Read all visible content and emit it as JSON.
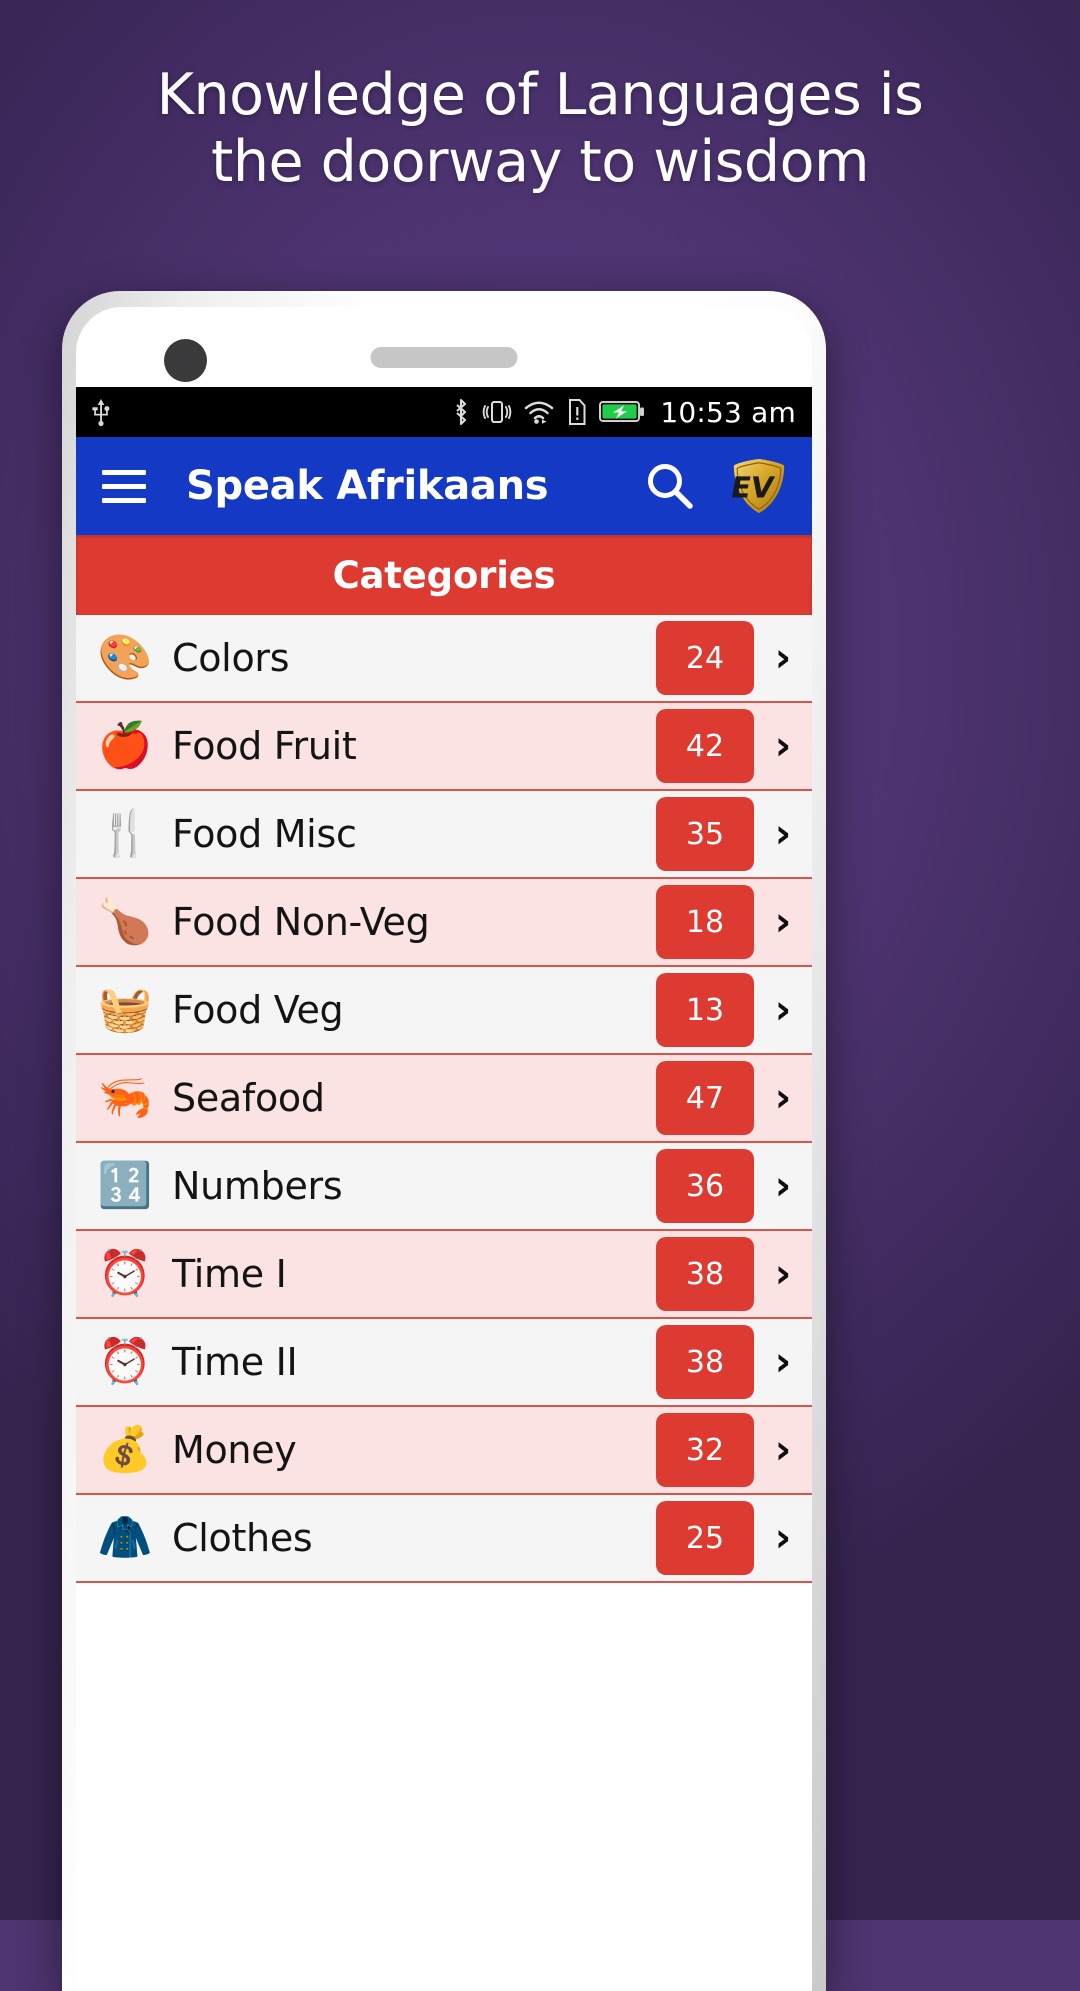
{
  "promo": {
    "headline_line1": "Knowledge of Languages is",
    "headline_line2": "the doorway to wisdom"
  },
  "statusbar": {
    "usb_icon": "usb-icon",
    "bluetooth_icon": "bluetooth-icon",
    "vibrate_icon": "vibrate-icon",
    "wifi_icon": "wifi-icon",
    "sim_alert_icon": "sim-card-alert-icon",
    "battery_icon": "battery-charging-icon",
    "clock": "10:53 am"
  },
  "appbar": {
    "menu_icon": "hamburger-menu-icon",
    "title": "Speak Afrikaans",
    "search_icon": "search-icon",
    "brand_logo": "ev-shield-logo",
    "brand_text": "EV",
    "bg_color": "#1439c4"
  },
  "section": {
    "header_title": "Categories",
    "header_color": "#dd3b32"
  },
  "categories": [
    {
      "emoji": "🎨",
      "icon_name": "paint-palette-icon",
      "label": "Colors",
      "count": "24",
      "chevron": "›"
    },
    {
      "emoji": "🍎",
      "icon_name": "apple-icon",
      "label": "Food Fruit",
      "count": "42",
      "chevron": "›"
    },
    {
      "emoji": "🍴",
      "icon_name": "fork-knife-icon",
      "label": "Food Misc",
      "count": "35",
      "chevron": "›"
    },
    {
      "emoji": "🍗",
      "icon_name": "poultry-leg-icon",
      "label": "Food Non-Veg",
      "count": "18",
      "chevron": "›"
    },
    {
      "emoji": "🧺",
      "icon_name": "vegetable-basket-icon",
      "label": "Food Veg",
      "count": "13",
      "chevron": "›"
    },
    {
      "emoji": "🦐",
      "icon_name": "shrimp-icon",
      "label": "Seafood",
      "count": "47",
      "chevron": "›"
    },
    {
      "emoji": "🔢",
      "icon_name": "numbers-123-icon",
      "label": "Numbers",
      "count": "36",
      "chevron": "›"
    },
    {
      "emoji": "⏰",
      "icon_name": "alarm-clock-icon",
      "label": "Time I",
      "count": "38",
      "chevron": "›"
    },
    {
      "emoji": "⏰",
      "icon_name": "alarm-clock-icon",
      "label": "Time II",
      "count": "38",
      "chevron": "›"
    },
    {
      "emoji": "💰",
      "icon_name": "money-bag-icon",
      "label": "Money",
      "count": "32",
      "chevron": "›"
    },
    {
      "emoji": "🧥",
      "icon_name": "jacket-icon",
      "label": "Clothes",
      "count": "25",
      "chevron": "›"
    }
  ],
  "theme": {
    "background": "#4e3470",
    "accent_red": "#dd3b32",
    "accent_blue": "#1439c4",
    "row_alt": "#fbe3e3"
  }
}
